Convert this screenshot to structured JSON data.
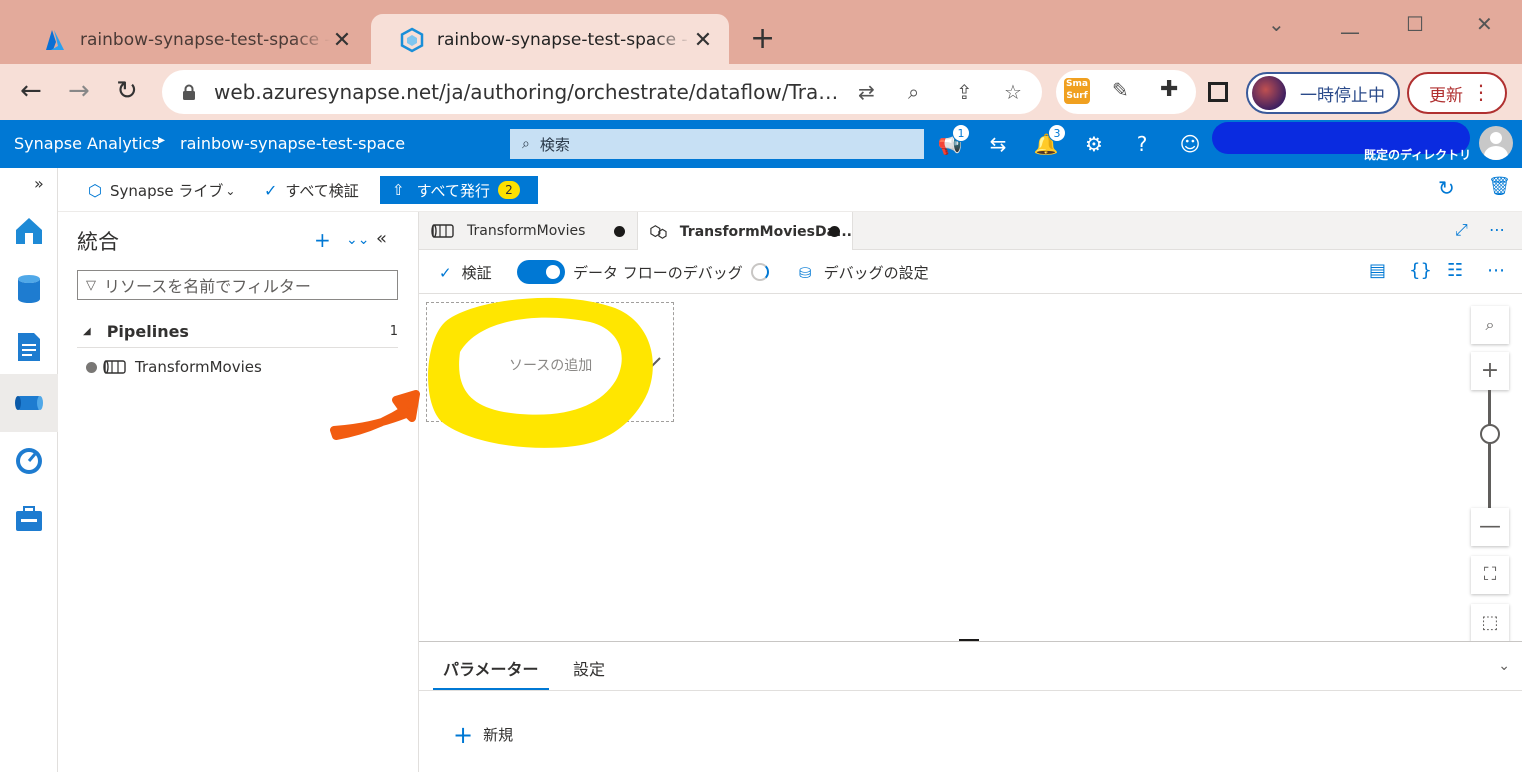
{
  "browser": {
    "tabs": [
      {
        "title": "rainbow-synapse-test-space - Mi",
        "active": false
      },
      {
        "title": "rainbow-synapse-test-space - Az",
        "active": true
      }
    ],
    "new_tab": "+",
    "url": "web.azuresynapse.net/ja/authoring/orchestrate/dataflow/Transfor...",
    "profile_label": "一時停止中",
    "update_label": "更新"
  },
  "header": {
    "brand": "Synapse Analytics",
    "workspace": "rainbow-synapse-test-space",
    "search_placeholder": "検索",
    "notification_badge_1": "1",
    "notification_badge_2": "3",
    "directory_label": "既定のディレクトリ"
  },
  "commandbar": {
    "live_label": "Synapse ライブ",
    "validate_all_label": "すべて検証",
    "publish_all_label": "すべて発行",
    "publish_count": "2"
  },
  "resources": {
    "title": "統合",
    "filter_placeholder": "リソースを名前でフィルター",
    "section_label": "Pipelines",
    "section_count": "1",
    "items": [
      {
        "label": "TransformMovies"
      }
    ]
  },
  "editor_tabs": [
    {
      "label": "TransformMovies"
    },
    {
      "label": "TransformMoviesDa..."
    }
  ],
  "designer_toolbar": {
    "validate_label": "検証",
    "debug_label": "データ フローのデバッグ",
    "debug_settings_label": "デバッグの設定"
  },
  "canvas": {
    "add_source_label": "ソースの追加"
  },
  "bottom_panel": {
    "tabs": [
      {
        "label": "パラメーター",
        "active": true
      },
      {
        "label": "設定",
        "active": false
      }
    ],
    "new_label": "新規"
  },
  "colors": {
    "azure_blue": "#0078d4",
    "browser_tabstrip": "#e3aa9b",
    "annotation_highlight": "#ffe600",
    "annotation_arrow": "#f25c10"
  }
}
